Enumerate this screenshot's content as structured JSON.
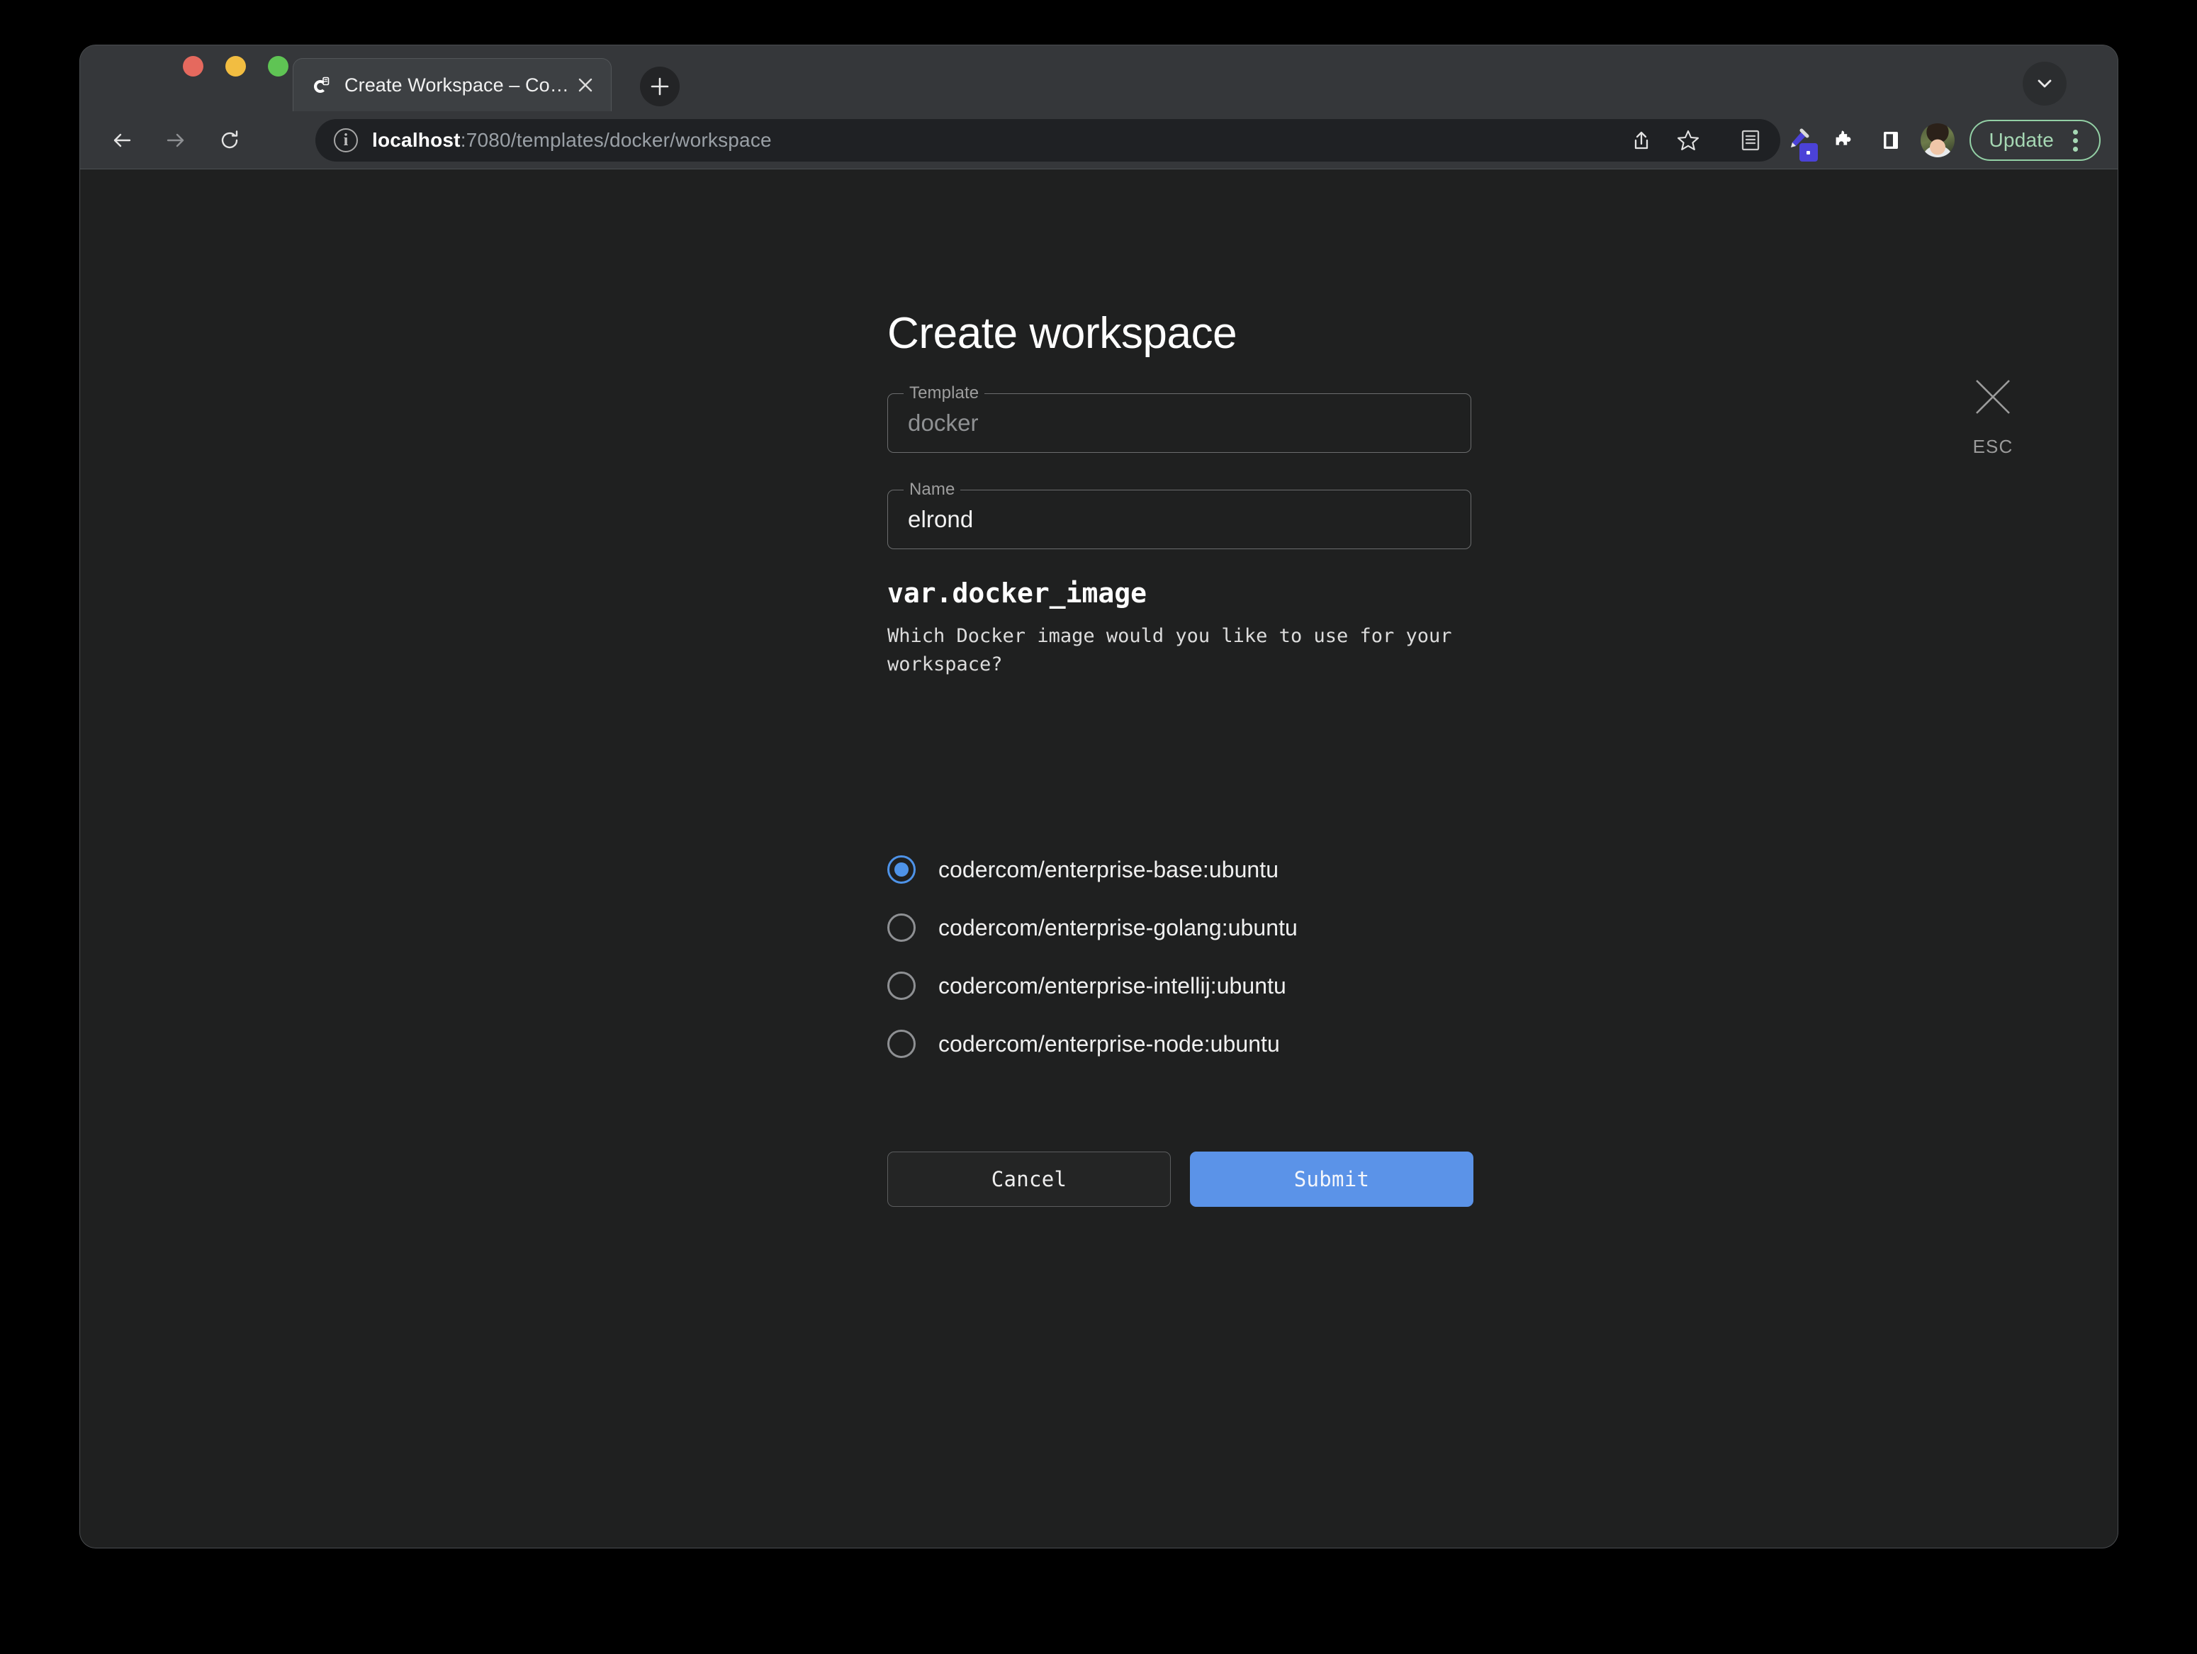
{
  "browser": {
    "traffic_lights": [
      {
        "name": "close",
        "color": "#e5695e"
      },
      {
        "name": "minimize",
        "color": "#f2bd41"
      },
      {
        "name": "maximize",
        "color": "#5fc454"
      }
    ],
    "tab": {
      "title": "Create Workspace – Coder",
      "favicon": "coder-logo-icon",
      "close_icon": "close-icon"
    },
    "new_tab_label": "+",
    "tabstrip_chevron_icon": "chevron-down-icon",
    "nav": {
      "back_icon": "back-arrow-icon",
      "forward_icon": "forward-arrow-icon",
      "reload_icon": "reload-icon"
    },
    "omnibox": {
      "site_info_icon": "info-circle-icon",
      "url_host": "localhost",
      "url_path": ":7080/templates/docker/workspace",
      "full_url": "localhost:7080/templates/docker/workspace",
      "share_icon": "share-icon",
      "bookmark_icon": "star-icon"
    },
    "toolbar_icons": [
      "reading-list-icon",
      "eyedropper-extension-icon",
      "extensions-puzzle-icon",
      "side-panel-icon"
    ],
    "profile_avatar": "avatar",
    "update_button": {
      "label": "Update",
      "menu_icon": "kebab-menu-icon",
      "accent_color": "#93d0a5"
    }
  },
  "page": {
    "title": "Create workspace",
    "close": {
      "icon": "close-x-icon",
      "hint": "ESC"
    },
    "fields": [
      {
        "id": "template",
        "legend": "Template",
        "value": "docker",
        "disabled": true
      },
      {
        "id": "name",
        "legend": "Name",
        "value": "elrond",
        "disabled": false
      }
    ],
    "variable": {
      "name": "var.docker_image",
      "description": "Which Docker image would you like to use for your workspace?",
      "options": [
        {
          "label": "codercom/enterprise-base:ubuntu",
          "selected": true
        },
        {
          "label": "codercom/enterprise-golang:ubuntu",
          "selected": false
        },
        {
          "label": "codercom/enterprise-intellij:ubuntu",
          "selected": false
        },
        {
          "label": "codercom/enterprise-node:ubuntu",
          "selected": false
        }
      ]
    },
    "actions": {
      "cancel_label": "Cancel",
      "submit_label": "Submit",
      "submit_color": "#5b93e8"
    }
  }
}
